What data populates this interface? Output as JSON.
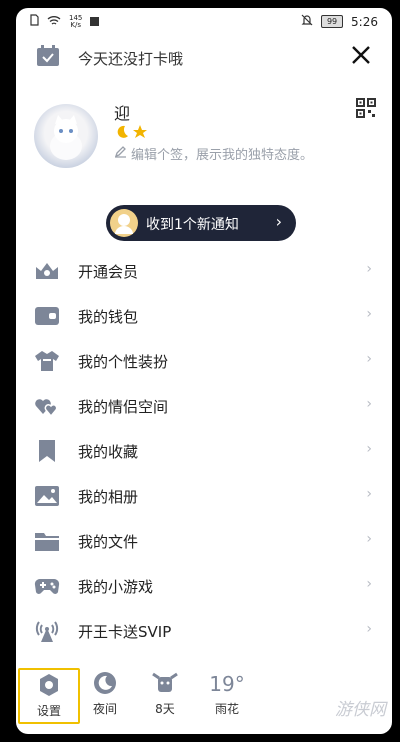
{
  "status_bar": {
    "net_speed_value": "145",
    "net_speed_unit": "K/s",
    "battery": "99",
    "time": "5:26"
  },
  "header": {
    "checkin_text": "今天还没打卡哦"
  },
  "profile": {
    "username": "迎",
    "signature": "编辑个签，展示我的独特态度。"
  },
  "notification": {
    "text": "收到1个新通知"
  },
  "menu": {
    "items": [
      {
        "label": "开通会员",
        "icon": "crown-icon"
      },
      {
        "label": "我的钱包",
        "icon": "wallet-icon"
      },
      {
        "label": "我的个性装扮",
        "icon": "shirt-icon"
      },
      {
        "label": "我的情侣空间",
        "icon": "hearts-icon"
      },
      {
        "label": "我的收藏",
        "icon": "bookmark-icon"
      },
      {
        "label": "我的相册",
        "icon": "photo-icon"
      },
      {
        "label": "我的文件",
        "icon": "folder-icon"
      },
      {
        "label": "我的小游戏",
        "icon": "gamepad-icon"
      },
      {
        "label": "开王卡送SVIP",
        "icon": "signal-tower-icon"
      }
    ]
  },
  "bottom_bar": {
    "settings_label": "设置",
    "night_label": "夜间",
    "days_label": "8天",
    "temperature": "19°",
    "weather_label": "雨花"
  },
  "watermark": "游侠网",
  "colors": {
    "icon": "#7d8698",
    "notice_bg": "#1f2538",
    "active_border": "#f0c000"
  }
}
